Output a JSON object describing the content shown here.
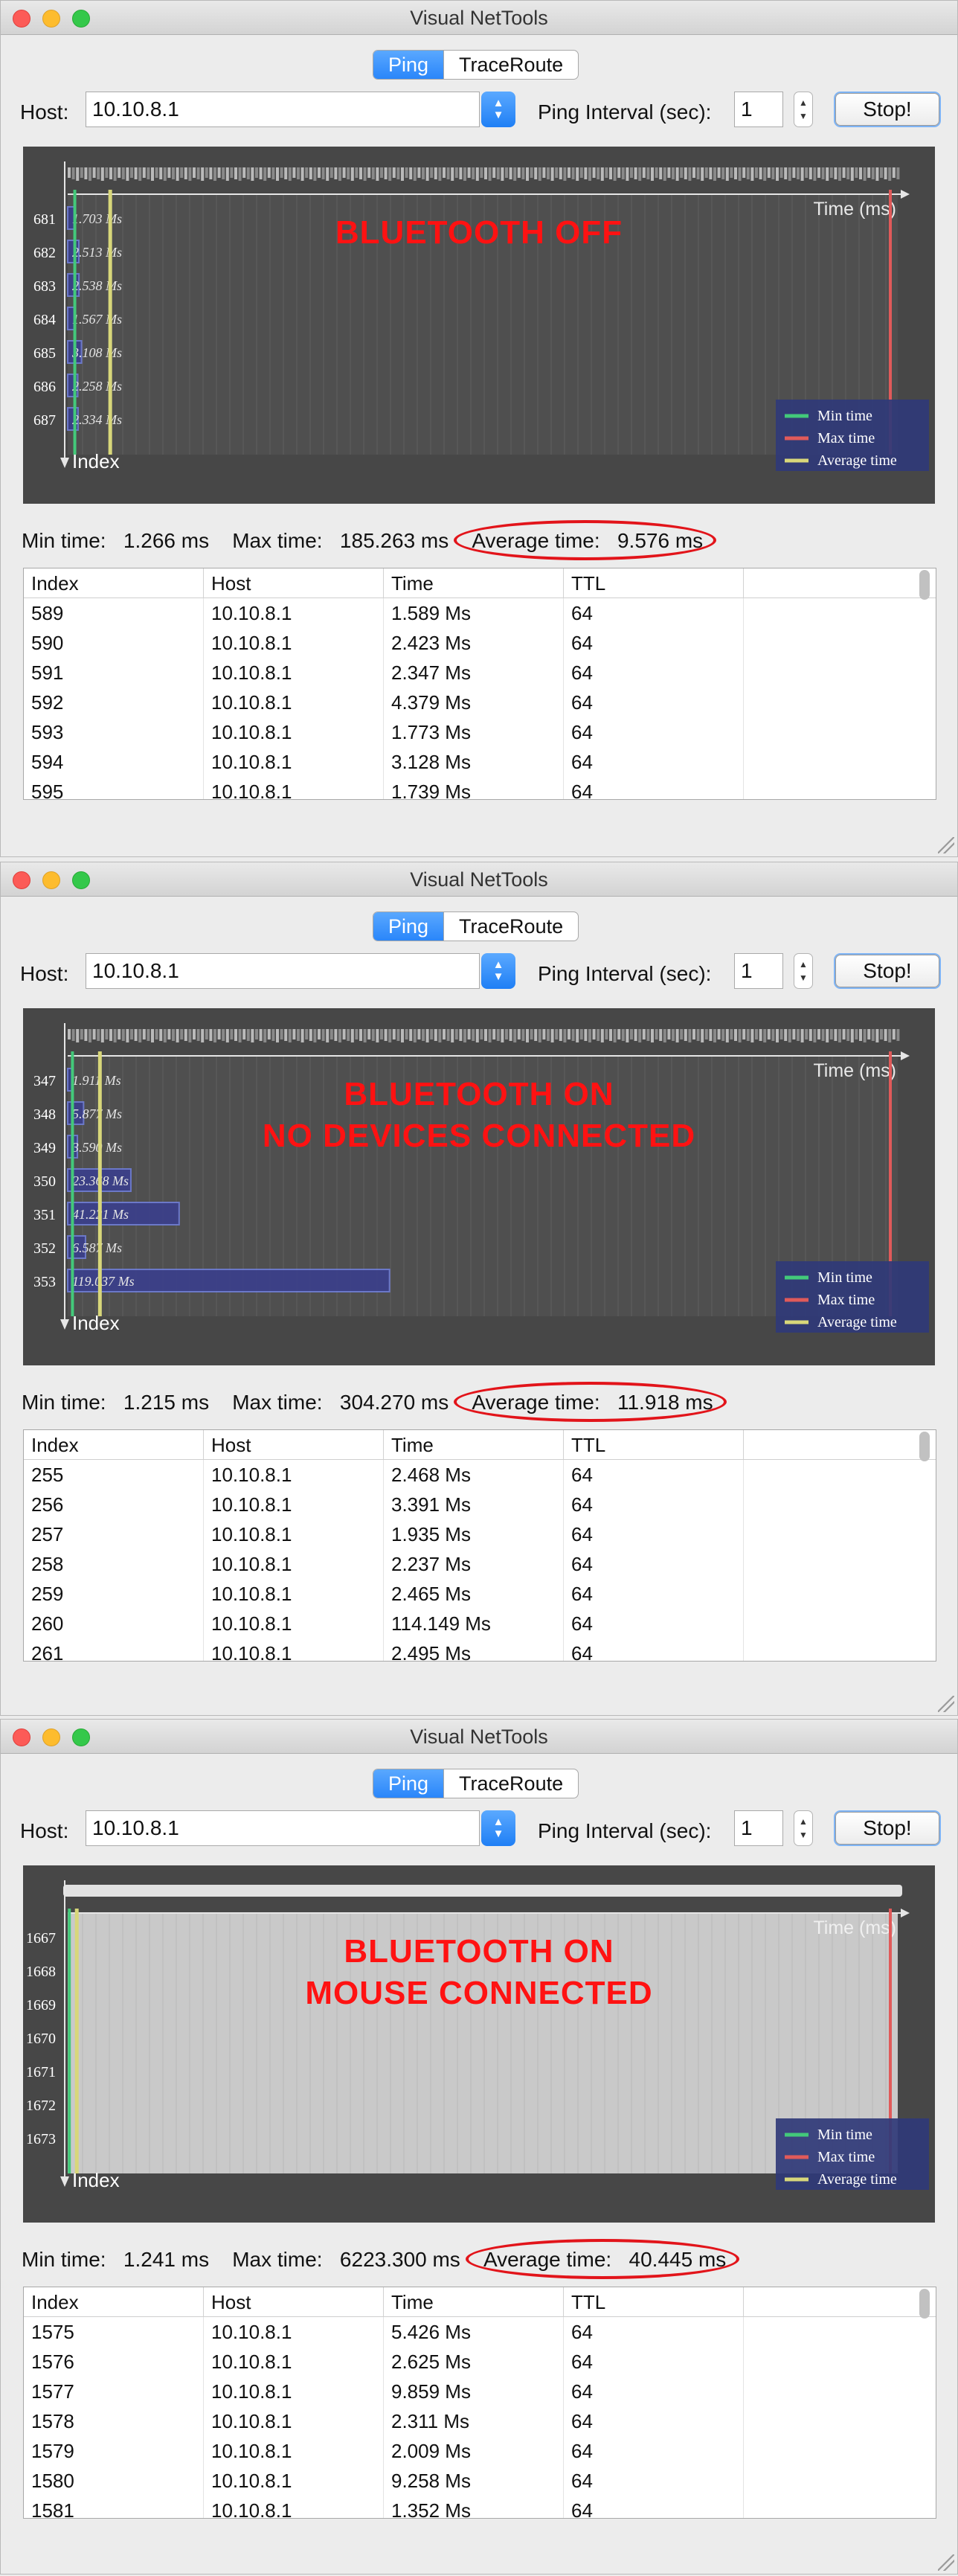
{
  "windows": [
    {
      "title": "Visual NetTools",
      "tabs": [
        "Ping",
        "TraceRoute"
      ],
      "host_label": "Host:",
      "host_value": "10.10.8.1",
      "interval_label": "Ping Interval (sec):",
      "interval_value": "1",
      "stop_label": "Stop!",
      "overlay_lines": [
        "BLUETOOTH OFF"
      ],
      "stats": {
        "min_label": "Min time:",
        "min_value": "1.266 ms",
        "max_label": "Max time:",
        "max_value": "185.263 ms",
        "avg_label": "Average time:",
        "avg_value": "9.576 ms"
      },
      "chart_data": {
        "type": "bar",
        "orientation": "horizontal",
        "x_label": "Time (ms)",
        "y_label": "Index",
        "categories": [
          "681",
          "682",
          "683",
          "684",
          "685",
          "686",
          "687"
        ],
        "series": [
          {
            "values": [
              1.703,
              2.513,
              2.538,
              1.567,
              3.108,
              2.258,
              2.334
            ]
          }
        ],
        "data_labels": [
          "1.703 Ms",
          "2.513 Ms",
          "2.538 Ms",
          "1.567 Ms",
          "3.108 Ms",
          "2.258 Ms",
          "2.334 Ms"
        ],
        "reference_lines": {
          "min": 1.266,
          "max": 185.263,
          "average": 9.576
        },
        "legend": {
          "position": "bottom-right",
          "entries": [
            "Min time",
            "Max time",
            "Average time"
          ]
        },
        "colors": {
          "min": "#43c97a",
          "max": "#e05a5a",
          "average": "#d8d77a",
          "bar_fill": "#3b3f8c",
          "bar_stroke": "#6f7dd6"
        },
        "grid": true
      },
      "table": {
        "headers": [
          "Index",
          "Host",
          "Time",
          "TTL",
          ""
        ],
        "rows": [
          [
            "589",
            "10.10.8.1",
            "1.589 Ms",
            "64",
            ""
          ],
          [
            "590",
            "10.10.8.1",
            "2.423 Ms",
            "64",
            ""
          ],
          [
            "591",
            "10.10.8.1",
            "2.347 Ms",
            "64",
            ""
          ],
          [
            "592",
            "10.10.8.1",
            "4.379 Ms",
            "64",
            ""
          ],
          [
            "593",
            "10.10.8.1",
            "1.773 Ms",
            "64",
            ""
          ],
          [
            "594",
            "10.10.8.1",
            "3.128 Ms",
            "64",
            ""
          ],
          [
            "595",
            "10.10.8.1",
            "1.739 Ms",
            "64",
            ""
          ]
        ]
      }
    },
    {
      "title": "Visual NetTools",
      "tabs": [
        "Ping",
        "TraceRoute"
      ],
      "host_label": "Host:",
      "host_value": "10.10.8.1",
      "interval_label": "Ping Interval (sec):",
      "interval_value": "1",
      "stop_label": "Stop!",
      "overlay_lines": [
        "BLUETOOTH ON",
        "NO DEVICES CONNECTED"
      ],
      "stats": {
        "min_label": "Min time:",
        "min_value": "1.215 ms",
        "max_label": "Max time:",
        "max_value": "304.270 ms",
        "avg_label": "Average time:",
        "avg_value": "11.918 ms"
      },
      "chart_data": {
        "type": "bar",
        "orientation": "horizontal",
        "x_label": "Time (ms)",
        "y_label": "Index",
        "categories": [
          "347",
          "348",
          "349",
          "350",
          "351",
          "352",
          "353"
        ],
        "series": [
          {
            "values": [
              1.911,
              5.877,
              3.59,
              23.368,
              41.221,
              6.587,
              119.037
            ]
          }
        ],
        "data_labels": [
          "1.911 Ms",
          "5.877 Ms",
          "3.590 Ms",
          "23.368 Ms",
          "41.221 Ms",
          "6.587 Ms",
          "119.037 Ms"
        ],
        "reference_lines": {
          "min": 1.215,
          "max": 304.27,
          "average": 11.918
        },
        "legend": {
          "position": "bottom-right",
          "entries": [
            "Min time",
            "Max time",
            "Average time"
          ]
        },
        "colors": {
          "min": "#43c97a",
          "max": "#e05a5a",
          "average": "#d8d77a",
          "bar_fill": "#3b3f8c",
          "bar_stroke": "#6f7dd6"
        },
        "grid": true
      },
      "table": {
        "headers": [
          "Index",
          "Host",
          "Time",
          "TTL",
          ""
        ],
        "rows": [
          [
            "255",
            "10.10.8.1",
            "2.468 Ms",
            "64",
            ""
          ],
          [
            "256",
            "10.10.8.1",
            "3.391 Ms",
            "64",
            ""
          ],
          [
            "257",
            "10.10.8.1",
            "1.935 Ms",
            "64",
            ""
          ],
          [
            "258",
            "10.10.8.1",
            "2.237 Ms",
            "64",
            ""
          ],
          [
            "259",
            "10.10.8.1",
            "2.465 Ms",
            "64",
            ""
          ],
          [
            "260",
            "10.10.8.1",
            "114.149 Ms",
            "64",
            ""
          ],
          [
            "261",
            "10.10.8.1",
            "2.495 Ms",
            "64",
            ""
          ]
        ]
      }
    },
    {
      "title": "Visual NetTools",
      "tabs": [
        "Ping",
        "TraceRoute"
      ],
      "host_label": "Host:",
      "host_value": "10.10.8.1",
      "interval_label": "Ping Interval (sec):",
      "interval_value": "1",
      "stop_label": "Stop!",
      "overlay_lines": [
        "BLUETOOTH ON",
        "MOUSE CONNECTED"
      ],
      "stats": {
        "min_label": "Min time:",
        "min_value": "1.241 ms",
        "max_label": "Max time:",
        "max_value": "6223.300 ms",
        "avg_label": "Average time:",
        "avg_value": "40.445 ms"
      },
      "chart_data": {
        "type": "bar",
        "orientation": "horizontal",
        "x_label": "Time (ms)",
        "y_label": "Index",
        "categories": [
          "1667",
          "1668",
          "1669",
          "1670",
          "1671",
          "1672",
          "1673"
        ],
        "series": [
          {
            "values": []
          }
        ],
        "data_labels": [],
        "reference_lines": {
          "min": 1.241,
          "max": 6223.3,
          "average": 40.445
        },
        "legend": {
          "position": "bottom-right",
          "entries": [
            "Min time",
            "Max time",
            "Average time"
          ]
        },
        "colors": {
          "min": "#43c97a",
          "max": "#e05a5a",
          "average": "#d8d77a",
          "bar_fill": "#3b3f8c",
          "bar_stroke": "#6f7dd6",
          "saturated_area": "#c9c9c9"
        },
        "grid": true
      },
      "table": {
        "headers": [
          "Index",
          "Host",
          "Time",
          "TTL",
          ""
        ],
        "rows": [
          [
            "1575",
            "10.10.8.1",
            "5.426 Ms",
            "64",
            ""
          ],
          [
            "1576",
            "10.10.8.1",
            "2.625 Ms",
            "64",
            ""
          ],
          [
            "1577",
            "10.10.8.1",
            "9.859 Ms",
            "64",
            ""
          ],
          [
            "1578",
            "10.10.8.1",
            "2.311 Ms",
            "64",
            ""
          ],
          [
            "1579",
            "10.10.8.1",
            "2.009 Ms",
            "64",
            ""
          ],
          [
            "1580",
            "10.10.8.1",
            "9.258 Ms",
            "64",
            ""
          ],
          [
            "1581",
            "10.10.8.1",
            "1.352 Ms",
            "64",
            ""
          ]
        ]
      }
    }
  ]
}
